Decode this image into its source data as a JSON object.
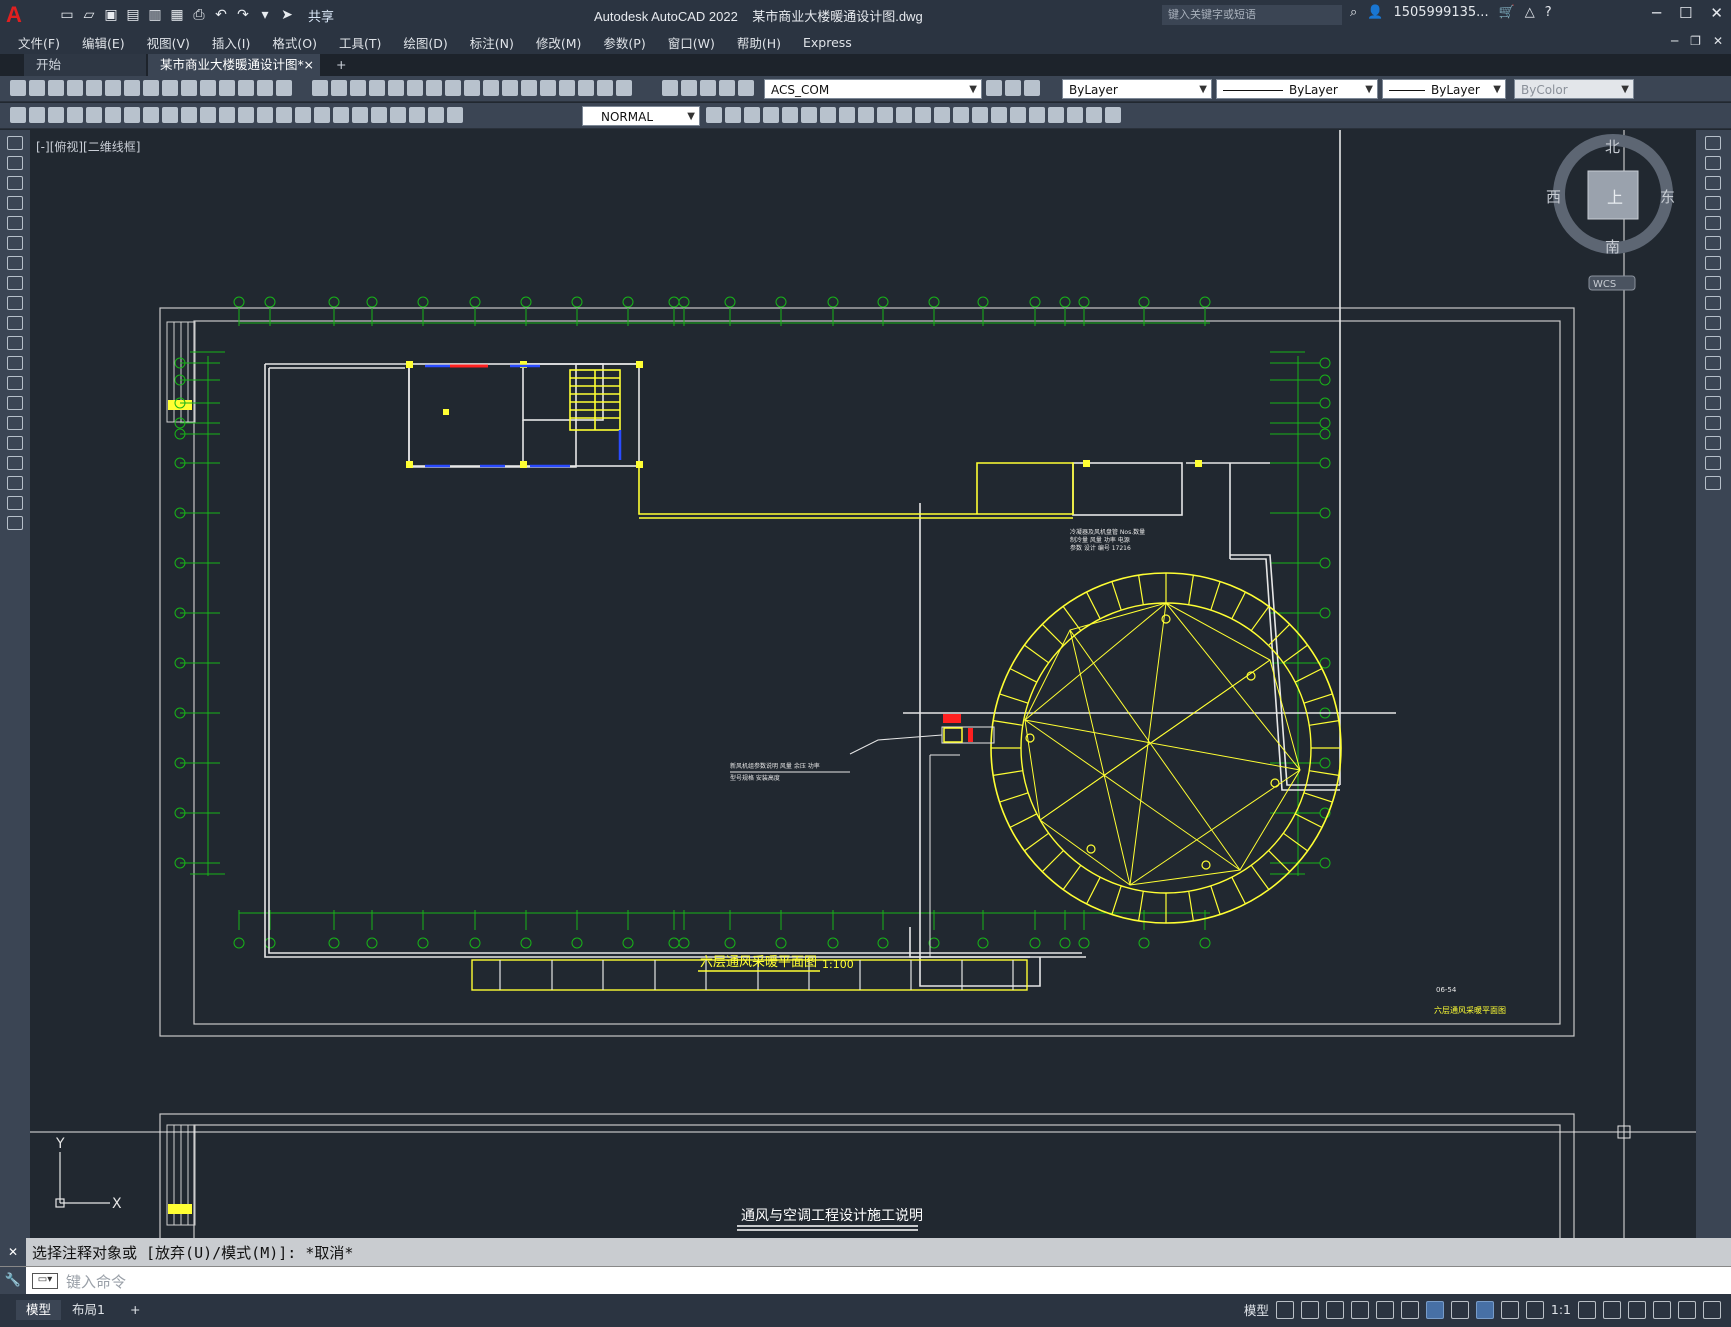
{
  "app": {
    "title": "Autodesk AutoCAD 2022",
    "file_name": "某市商业大楼暖通设计图.dwg",
    "share_label": "共享",
    "search_placeholder": "键入关键字或短语",
    "user": "1505999135...",
    "logo_text": "A"
  },
  "menu": [
    "文件(F)",
    "编辑(E)",
    "视图(V)",
    "插入(I)",
    "格式(O)",
    "工具(T)",
    "绘图(D)",
    "标注(N)",
    "修改(M)",
    "参数(P)",
    "窗口(W)",
    "帮助(H)",
    "Express"
  ],
  "tabs": {
    "start": "开始",
    "active": "某市商业大楼暖通设计图*",
    "add": "+",
    "close": "×"
  },
  "toolbar": {
    "layer": "ACS_COM",
    "color": "ByLayer",
    "linetype": "ByLayer",
    "lineweight": "ByLayer",
    "plotstyle": "ByColor",
    "dimstyle": "NORMAL"
  },
  "viewport": {
    "label": "[-][俯视][二维线框]",
    "viewcube": {
      "north": "北",
      "south": "南",
      "east": "东",
      "west": "西",
      "top": "上",
      "wcs": "WCS"
    },
    "ucs": {
      "x": "X",
      "y": "Y"
    }
  },
  "drawing": {
    "plan_title": "六层通风采暖平面图",
    "plan_scale": "1:100",
    "notes_title": "通风与空调工程设计施工说明",
    "titleblock_code": "06-54",
    "titleblock_name": "六层通风采暖平面图"
  },
  "command": {
    "history": "选择注释对象或 [放弃(U)/模式(M)]: *取消*",
    "placeholder": "键入命令"
  },
  "status": {
    "model_tab": "模型",
    "layout_tab": "布局1",
    "add_tab": "+",
    "model_label": "模型",
    "scale": "1:1"
  },
  "colors": {
    "canvas": "#212830",
    "grid_green": "#18b418",
    "wall_white": "#e6e6e6",
    "yellow": "#ffff33",
    "blue": "#2a4bff",
    "red": "#ff2020"
  }
}
